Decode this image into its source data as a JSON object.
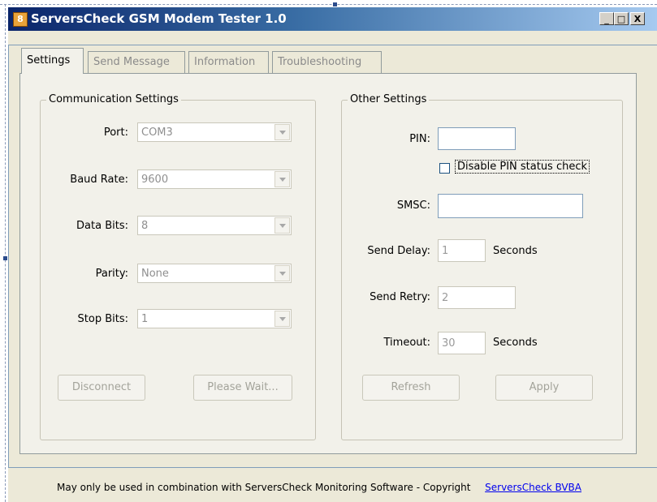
{
  "window": {
    "title": "ServersCheck GSM Modem Tester 1.0",
    "controls": {
      "minimize": "_",
      "maximize": "□",
      "close": "X"
    }
  },
  "tabs": [
    {
      "label": "Settings",
      "active": true
    },
    {
      "label": "Send Message",
      "active": false
    },
    {
      "label": "Information",
      "active": false
    },
    {
      "label": "Troubleshooting",
      "active": false
    }
  ],
  "communication": {
    "title": "Communication Settings",
    "port": {
      "label": "Port:",
      "value": "COM3"
    },
    "baud_rate": {
      "label": "Baud Rate:",
      "value": "9600"
    },
    "data_bits": {
      "label": "Data Bits:",
      "value": "8"
    },
    "parity": {
      "label": "Parity:",
      "value": "None"
    },
    "stop_bits": {
      "label": "Stop Bits:",
      "value": "1"
    },
    "disconnect_label": "Disconnect",
    "wait_label": "Please Wait..."
  },
  "other": {
    "title": "Other Settings",
    "pin": {
      "label": "PIN:",
      "value": ""
    },
    "disable_pin_label": "Disable PIN status check",
    "smsc": {
      "label": "SMSC:",
      "value": ""
    },
    "send_delay": {
      "label": "Send Delay:",
      "value": "1",
      "unit": "Seconds"
    },
    "send_retry": {
      "label": "Send Retry:",
      "value": "2"
    },
    "timeout": {
      "label": "Timeout:",
      "value": "30",
      "unit": "Seconds"
    },
    "refresh_label": "Refresh",
    "apply_label": "Apply"
  },
  "footer": {
    "text": "May only be used in combination with  ServersCheck Monitoring Software - Copyright",
    "link": "ServersCheck BVBA"
  },
  "colors": {
    "title_start": "#0a246a",
    "title_end": "#a6caf0",
    "face": "#ece9d8",
    "link": "#0000ee"
  }
}
